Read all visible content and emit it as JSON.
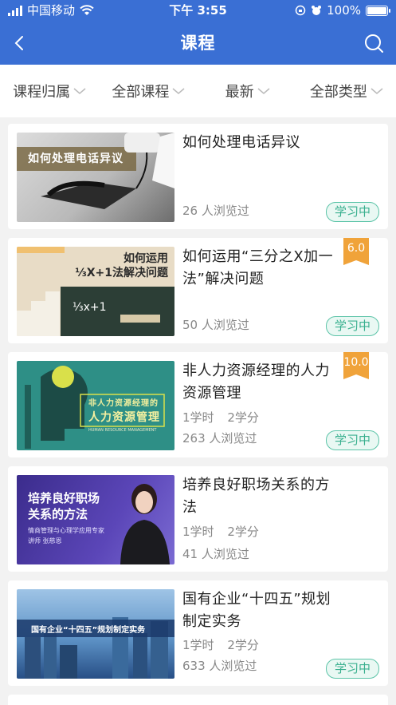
{
  "status_bar": {
    "carrier": "中国移动",
    "time": "下午 3:55",
    "battery": "100%"
  },
  "nav": {
    "title": "课程",
    "back_icon": "chevron-left-icon",
    "search_icon": "search-icon"
  },
  "filters": [
    {
      "label": "课程归属"
    },
    {
      "label": "全部课程"
    },
    {
      "label": "最新"
    },
    {
      "label": "全部类型"
    }
  ],
  "courses": [
    {
      "title": "如何处理电话异议",
      "thumb_text": "如何处理电话异议",
      "views": "26 人浏览过",
      "status": "学习中"
    },
    {
      "title": "如何运用“三分之X加一法”解决问题",
      "thumb_text": "如何运用\n⅓X+1法解决问题",
      "views": "50 人浏览过",
      "status": "学习中",
      "score": "6.0"
    },
    {
      "title": "非人力资源经理的人力资源管理",
      "thumb_text_small": "非人力资源经理的",
      "thumb_text_big": "人力资源管理",
      "thumb_text_en": "HUMAN RESOURCE MANAGEMENT",
      "hours": "1学时",
      "credits": "2学分",
      "views": "263 人浏览过",
      "status": "学习中",
      "score": "10.0"
    },
    {
      "title": "培养良好职场关系的方法",
      "thumb_text_1": "培养良好职场",
      "thumb_text_2": "关系的方法",
      "thumb_text_3": "情商管理与心理学应用专家",
      "thumb_text_4": "讲师  张慈恩",
      "hours": "1学时",
      "credits": "2学分",
      "views": "41 人浏览过"
    },
    {
      "title": "国有企业“十四五”规划制定实务",
      "thumb_text": "国有企业“十四五”规划制定实务",
      "hours": "1学时",
      "credits": "2学分",
      "views": "633 人浏览过",
      "status": "学习中"
    }
  ],
  "colors": {
    "header_bg": "#3a6fd4",
    "badge_green": "#3ab08f",
    "score_orange": "#f0a33a"
  }
}
